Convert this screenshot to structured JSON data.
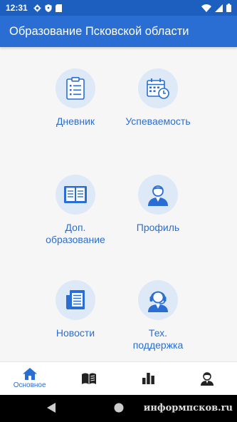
{
  "status_bar": {
    "time": "12:31"
  },
  "app_bar": {
    "title": "Образование Псковской области"
  },
  "menu": [
    {
      "label": "Дневник",
      "icon": "clipboard-icon"
    },
    {
      "label": "Успеваемость",
      "icon": "calendar-clock-icon"
    },
    {
      "label": "Доп. образование",
      "icon": "open-book-icon"
    },
    {
      "label": "Профиль",
      "icon": "user-icon"
    },
    {
      "label": "Новости",
      "icon": "newspaper-icon"
    },
    {
      "label": "Тех. поддержка",
      "icon": "headset-operator-icon"
    }
  ],
  "bottom_nav": {
    "active": "Основное",
    "items": [
      {
        "label": "Основное",
        "icon": "home-icon"
      },
      {
        "icon": "book-icon"
      },
      {
        "icon": "bar-chart-icon"
      },
      {
        "icon": "person-icon"
      }
    ]
  },
  "watermark": "информпсков.ru",
  "colors": {
    "primary": "#2a6ed3",
    "status_bar": "#1d5fbf",
    "icon_circle": "#dde9f6",
    "background": "#f6f6f6"
  }
}
